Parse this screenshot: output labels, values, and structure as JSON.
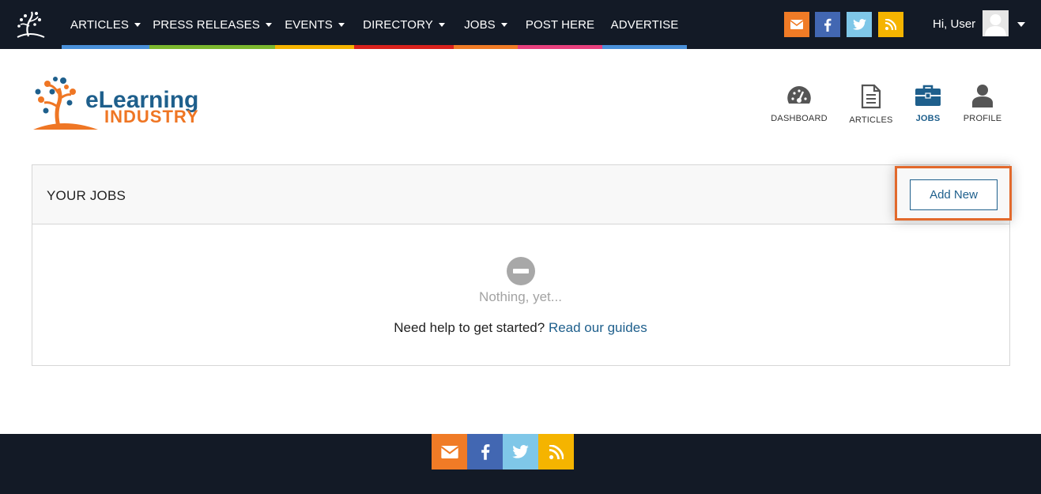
{
  "nav": {
    "items": [
      {
        "label": "ARTICLES",
        "dropdown": true,
        "color": "#4a90d9"
      },
      {
        "label": "PRESS RELEASES",
        "dropdown": true,
        "color": "#7cb82f"
      },
      {
        "label": "EVENTS",
        "dropdown": true,
        "color": "#f5b400"
      },
      {
        "label": "DIRECTORY",
        "dropdown": true,
        "color": "#d9211c"
      },
      {
        "label": "JOBS",
        "dropdown": true,
        "color": "#f07b26"
      },
      {
        "label": "POST HERE",
        "dropdown": false,
        "color": "#e8407d"
      },
      {
        "label": "ADVERTISE",
        "dropdown": false,
        "color": "#4a90d9"
      }
    ]
  },
  "social": {
    "email_color": "#f07b26",
    "facebook_color": "#4267b2",
    "twitter_color": "#7fc7e8",
    "rss_color": "#f5b400"
  },
  "user": {
    "greeting": "Hi, User"
  },
  "brand": {
    "line1": "eLearning",
    "line2": "INDUSTRY"
  },
  "dashboard_nav": {
    "dashboard": "DASHBOARD",
    "articles": "ARTICLES",
    "jobs": "JOBS",
    "profile": "PROFILE"
  },
  "jobs_panel": {
    "title": "YOUR JOBS",
    "add_new": "Add New",
    "empty_text": "Nothing, yet...",
    "help_text": "Need help to get started?",
    "help_link": "Read our guides"
  },
  "colors": {
    "accent": "#1e5f8c",
    "dark_bg": "#131a26",
    "highlight": "#e2692c"
  }
}
